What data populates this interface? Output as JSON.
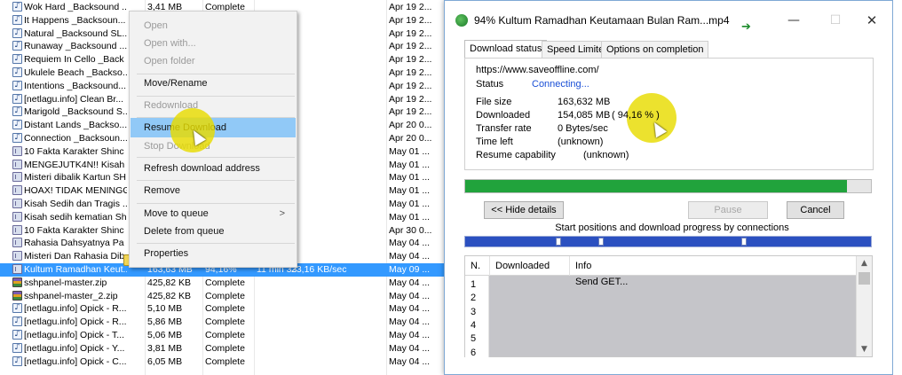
{
  "download_list": {
    "rows": [
      {
        "icon": "music",
        "name": "Wok Hard _Backsound ...",
        "size": "3,41 MB",
        "status": "Complete",
        "time": "",
        "rate": "",
        "date": "Apr 19 2..."
      },
      {
        "icon": "music",
        "name": "It Happens _Backsoun...",
        "size": "3,47 MB",
        "status": "Complete",
        "time": "",
        "rate": "",
        "date": "Apr 19 2..."
      },
      {
        "icon": "music",
        "name": "Natural _Backsound SL...",
        "size": "",
        "status": "",
        "time": "",
        "rate": "",
        "date": "Apr 19 2..."
      },
      {
        "icon": "music",
        "name": "Runaway _Backsound ...",
        "size": "",
        "status": "",
        "time": "",
        "rate": "",
        "date": "Apr 19 2..."
      },
      {
        "icon": "music",
        "name": "Requiem In Cello _Back",
        "size": "",
        "status": "",
        "time": "",
        "rate": "",
        "date": "Apr 19 2..."
      },
      {
        "icon": "music",
        "name": "Ukulele Beach _Backso...",
        "size": "",
        "status": "",
        "time": "",
        "rate": "",
        "date": "Apr 19 2..."
      },
      {
        "icon": "music",
        "name": "Intentions _Backsound...",
        "size": "",
        "status": "",
        "time": "",
        "rate": "",
        "date": "Apr 19 2..."
      },
      {
        "icon": "music",
        "name": "[netlagu.info] Clean Br...",
        "size": "",
        "status": "",
        "time": "",
        "rate": "",
        "date": "Apr 19 2..."
      },
      {
        "icon": "music",
        "name": "Marigold _Backsound S...",
        "size": "",
        "status": "",
        "time": "",
        "rate": "",
        "date": "Apr 19 2..."
      },
      {
        "icon": "music",
        "name": "Distant Lands _Backso...",
        "size": "",
        "status": "",
        "time": "",
        "rate": "",
        "date": "Apr 20 0..."
      },
      {
        "icon": "music",
        "name": "Connection _Backsoun...",
        "size": "",
        "status": "",
        "time": "",
        "rate": "",
        "date": "Apr 20 0..."
      },
      {
        "icon": "video",
        "name": "10 Fakta Karakter Shinc",
        "size": "",
        "status": "",
        "time": "",
        "rate": "",
        "date": "May 01 ..."
      },
      {
        "icon": "video",
        "name": "MENGEJUTK4N!! Kisah ...",
        "size": "",
        "status": "",
        "time": "",
        "rate": "",
        "date": "May 01 ..."
      },
      {
        "icon": "video",
        "name": "Misteri dibalik Kartun SH",
        "size": "",
        "status": "",
        "time": "",
        "rate": "",
        "date": "May 01 ..."
      },
      {
        "icon": "video",
        "name": "HOAX! TIDAK MENINGG",
        "size": "",
        "status": "",
        "time": "",
        "rate": "",
        "date": "May 01 ..."
      },
      {
        "icon": "video",
        "name": "Kisah Sedih dan Tragis ...",
        "size": "",
        "status": "",
        "time": "",
        "rate": "",
        "date": "May 01 ..."
      },
      {
        "icon": "video",
        "name": "Kisah sedih kematian Sh",
        "size": "",
        "status": "",
        "time": "",
        "rate": "",
        "date": "May 01 ..."
      },
      {
        "icon": "video",
        "name": "10 Fakta Karakter Shinc",
        "size": "",
        "status": "",
        "time": "",
        "rate": "",
        "date": "Apr 30 0..."
      },
      {
        "icon": "video",
        "name": "Rahasia Dahsyatnya Pa",
        "size": "",
        "status": "",
        "time": "",
        "rate": "",
        "date": "May 04 ..."
      },
      {
        "icon": "video",
        "name": "Misteri Dan Rahasia Dib...",
        "size": "",
        "status": "",
        "time": "",
        "rate": "",
        "date": "May 04 ..."
      },
      {
        "icon": "video",
        "name": "Kultum Ramadhan Keut...",
        "size": "163,63 MB",
        "status": "94,16%",
        "time": "11 min 33 ...",
        "rate": "23,16 KB/sec",
        "date": "May 09 ...",
        "selected": true
      },
      {
        "icon": "zip",
        "name": "sshpanel-master.zip",
        "size": "425,82 KB",
        "status": "Complete",
        "time": "",
        "rate": "",
        "date": "May 04 ..."
      },
      {
        "icon": "zip",
        "name": "sshpanel-master_2.zip",
        "size": "425,82 KB",
        "status": "Complete",
        "time": "",
        "rate": "",
        "date": "May 04 ..."
      },
      {
        "icon": "music",
        "name": "[netlagu.info] Opick - R...",
        "size": "5,10 MB",
        "status": "Complete",
        "time": "",
        "rate": "",
        "date": "May 04 ..."
      },
      {
        "icon": "music",
        "name": "[netlagu.info] Opick - R...",
        "size": "5,86 MB",
        "status": "Complete",
        "time": "",
        "rate": "",
        "date": "May 04 ..."
      },
      {
        "icon": "music",
        "name": "[netlagu.info] Opick - T...",
        "size": "5,06 MB",
        "status": "Complete",
        "time": "",
        "rate": "",
        "date": "May 04 ..."
      },
      {
        "icon": "music",
        "name": "[netlagu.info] Opick - Y...",
        "size": "3,81 MB",
        "status": "Complete",
        "time": "",
        "rate": "",
        "date": "May 04 ..."
      },
      {
        "icon": "music",
        "name": "[netlagu.info] Opick - C...",
        "size": "6,05 MB",
        "status": "Complete",
        "time": "",
        "rate": "",
        "date": "May 04 ..."
      }
    ]
  },
  "context_menu": {
    "open": "Open",
    "open_with": "Open with...",
    "open_folder": "Open folder",
    "move_rename": "Move/Rename",
    "redownload": "Redownload",
    "resume_download": "Resume Download",
    "stop_download": "Stop Download",
    "refresh_address": "Refresh download address",
    "remove": "Remove",
    "move_to_queue": "Move to queue",
    "move_to_queue_arrow": ">",
    "delete_from_queue": "Delete from queue",
    "properties": "Properties"
  },
  "dialog": {
    "title": "94% Kultum Ramadhan  Keutamaan Bulan Ram...mp4",
    "window_buttons": {
      "minimize": "—",
      "maximize": "☐",
      "close": "✕"
    },
    "tabs": [
      "Download status",
      "Speed Limiter",
      "Options on completion"
    ],
    "url": "https://www.saveoffline.com/",
    "status_label": "Status",
    "status_value": "Connecting...",
    "file_size_label": "File size",
    "file_size_value": "163,632  MB",
    "downloaded_label": "Downloaded",
    "downloaded_value": "154,085  MB",
    "downloaded_percent": "( 94,16 % )",
    "transfer_rate_label": "Transfer rate",
    "transfer_rate_value": "0  Bytes/sec",
    "time_left_label": "Time left",
    "time_left_value": "(unknown)",
    "resume_label": "Resume capability",
    "resume_value": "(unknown)",
    "progress_fraction": 0.9416,
    "hide_details_button": "<< Hide details",
    "pause_button": "Pause",
    "cancel_button": "Cancel",
    "connections_label": "Start positions and download progress by connections",
    "table": {
      "headers": [
        "N.",
        "Downloaded",
        "Info"
      ],
      "rows": [
        {
          "n": "1",
          "downloaded": "",
          "info": "Send GET..."
        },
        {
          "n": "2",
          "downloaded": "",
          "info": ""
        },
        {
          "n": "3",
          "downloaded": "",
          "info": ""
        },
        {
          "n": "4",
          "downloaded": "",
          "info": ""
        },
        {
          "n": "5",
          "downloaded": "",
          "info": ""
        },
        {
          "n": "6",
          "downloaded": "",
          "info": ""
        }
      ]
    }
  },
  "colors": {
    "accent": "#3399ff",
    "progress": "#21a33c",
    "highlight": "#e8dc00",
    "connecting": "#1a4fd6"
  }
}
